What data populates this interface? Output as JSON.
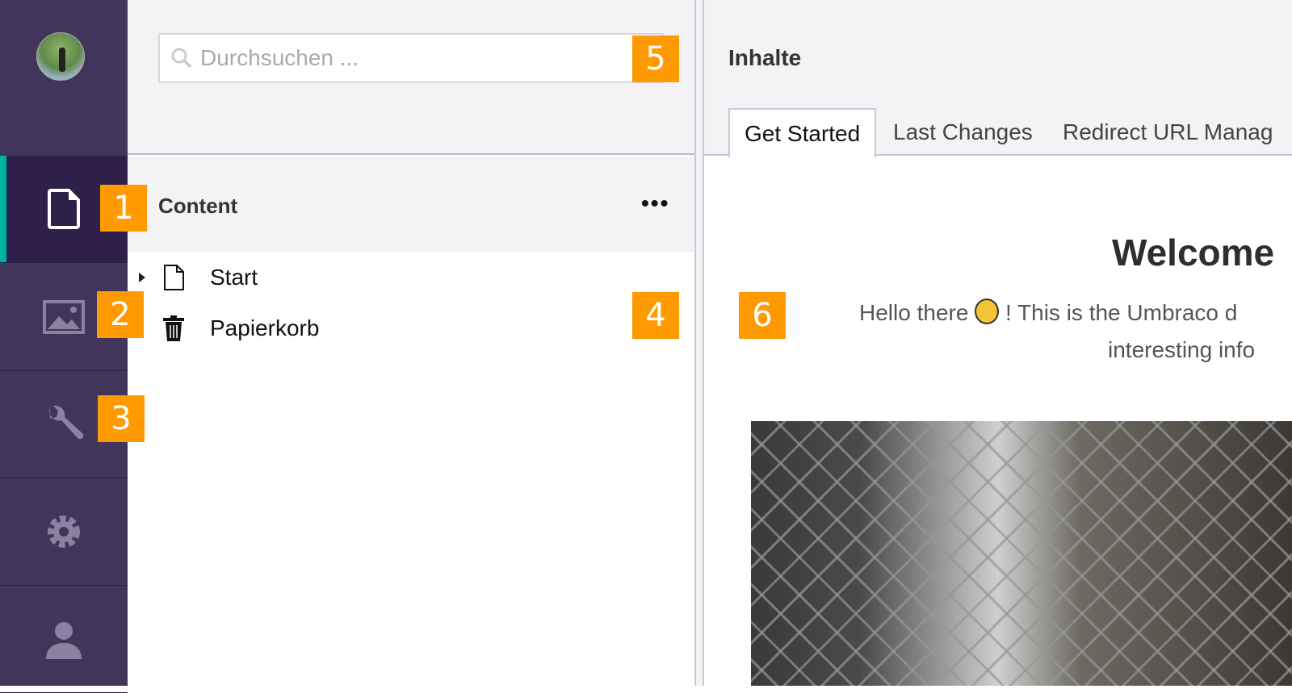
{
  "sidebar": {
    "items": [
      {
        "name": "content",
        "icon": "document-icon",
        "active": true
      },
      {
        "name": "media",
        "icon": "image-icon"
      },
      {
        "name": "settings",
        "icon": "wrench-icon"
      },
      {
        "name": "packages",
        "icon": "gear-icon"
      },
      {
        "name": "users",
        "icon": "user-icon"
      }
    ],
    "accent": "#00b2a1",
    "bg": "#413659"
  },
  "search": {
    "placeholder": "Durchsuchen ..."
  },
  "tree": {
    "title": "Content",
    "menu": "•••",
    "nodes": [
      {
        "label": "Start",
        "icon": "document-icon"
      },
      {
        "label": "Papierkorb",
        "icon": "trash-icon"
      }
    ]
  },
  "main": {
    "title": "Inhalte",
    "tabs": [
      "Get Started",
      "Last Changes",
      "Redirect URL Manag"
    ],
    "welcome": "Welcome",
    "hello_pre": "Hello there",
    "hello_post": "! This is the Umbraco d",
    "hello_line2": "interesting info"
  },
  "badges": [
    "1",
    "2",
    "3",
    "4",
    "5",
    "6"
  ],
  "badge_color": "#ff9a00"
}
